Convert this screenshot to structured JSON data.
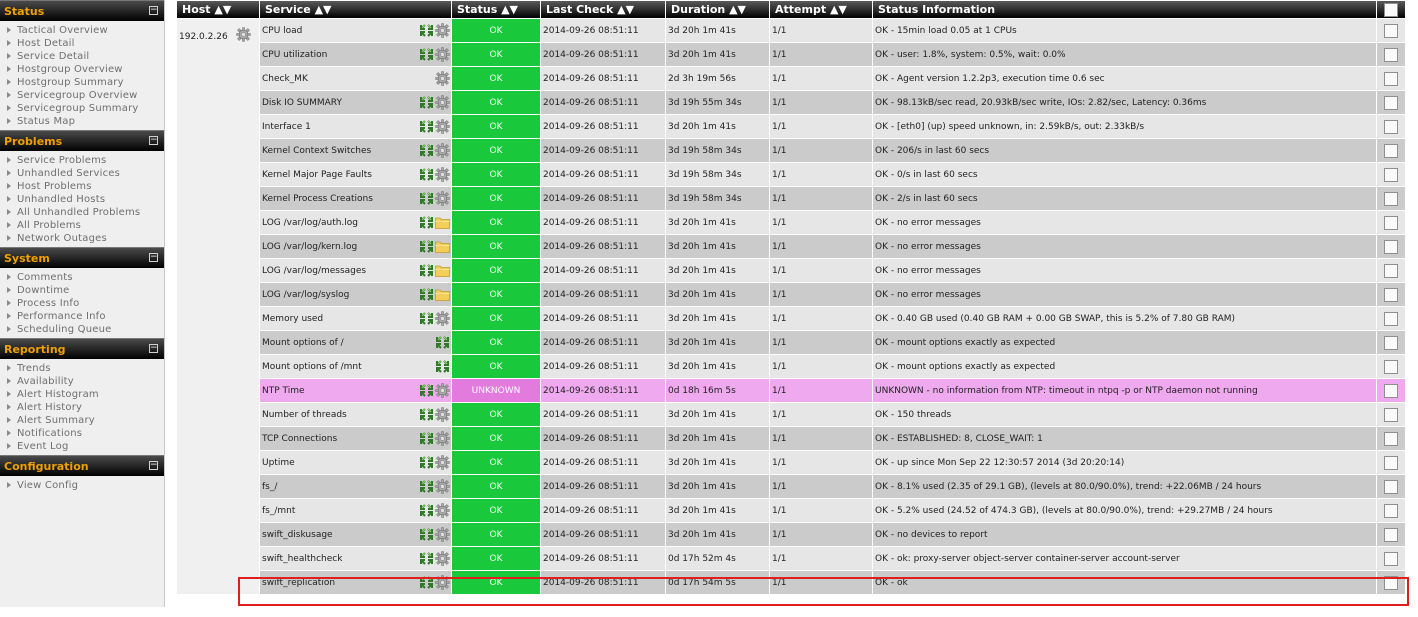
{
  "sidebar": {
    "sections": [
      {
        "title": "Status",
        "toggle": "⊟",
        "items": [
          "Tactical Overview",
          "Host Detail",
          "Service Detail",
          "Hostgroup Overview",
          "Hostgroup Summary",
          "Servicegroup Overview",
          "Servicegroup Summary",
          "Status Map"
        ]
      },
      {
        "title": "Problems",
        "toggle": "⊟",
        "items": [
          "Service Problems",
          "Unhandled Services",
          "Host Problems",
          "Unhandled Hosts",
          "All Unhandled Problems",
          "All Problems",
          "Network Outages"
        ]
      },
      {
        "title": "System",
        "toggle": "⊟",
        "items": [
          "Comments",
          "Downtime",
          "Process Info",
          "Performance Info",
          "Scheduling Queue"
        ]
      },
      {
        "title": "Reporting",
        "toggle": "⊟",
        "items": [
          "Trends",
          "Availability",
          "Alert Histogram",
          "Alert History",
          "Alert Summary",
          "Notifications",
          "Event Log"
        ]
      },
      {
        "title": "Configuration",
        "toggle": "⊟",
        "items": [
          "View Config"
        ]
      }
    ]
  },
  "table": {
    "columns": {
      "host": "Host",
      "service": "Service",
      "status": "Status",
      "last_check": "Last Check",
      "duration": "Duration",
      "attempt": "Attempt",
      "status_info": "Status Information"
    },
    "sort_glyph": "▲▼",
    "host": "192.0.2.26",
    "colors": {
      "ok": "#19c83b",
      "unknown": "#e37bde",
      "unknown_row": "#efa9ee",
      "highlight": "#e01e1e"
    },
    "rows": [
      {
        "service": "CPU load",
        "icons": [
          "graph-icon",
          "gear-icon"
        ],
        "status": "OK",
        "state": "ok",
        "last_check": "2014-09-26 08:51:11",
        "duration": "3d 20h 1m 41s",
        "attempt": "1/1",
        "info": "OK - 15min load 0.05 at 1 CPUs"
      },
      {
        "service": "CPU utilization",
        "icons": [
          "graph-icon",
          "gear-icon"
        ],
        "status": "OK",
        "state": "ok",
        "last_check": "2014-09-26 08:51:11",
        "duration": "3d 20h 1m 41s",
        "attempt": "1/1",
        "info": "OK - user: 1.8%, system: 0.5%, wait: 0.0%"
      },
      {
        "service": "Check_MK",
        "icons": [
          "gear-icon"
        ],
        "status": "OK",
        "state": "ok",
        "last_check": "2014-09-26 08:51:11",
        "duration": "2d 3h 19m 56s",
        "attempt": "1/1",
        "info": "OK - Agent version 1.2.2p3, execution time 0.6 sec"
      },
      {
        "service": "Disk IO SUMMARY",
        "icons": [
          "graph-icon",
          "gear-icon"
        ],
        "status": "OK",
        "state": "ok",
        "last_check": "2014-09-26 08:51:11",
        "duration": "3d 19h 55m 34s",
        "attempt": "1/1",
        "info": "OK - 98.13kB/sec read, 20.93kB/sec write, IOs: 2.82/sec, Latency: 0.36ms"
      },
      {
        "service": "Interface 1",
        "icons": [
          "graph-icon",
          "gear-icon"
        ],
        "status": "OK",
        "state": "ok",
        "last_check": "2014-09-26 08:51:11",
        "duration": "3d 20h 1m 41s",
        "attempt": "1/1",
        "info": "OK - [eth0] (up) speed unknown, in: 2.59kB/s, out: 2.33kB/s"
      },
      {
        "service": "Kernel Context Switches",
        "icons": [
          "graph-icon",
          "gear-icon"
        ],
        "status": "OK",
        "state": "ok",
        "last_check": "2014-09-26 08:51:11",
        "duration": "3d 19h 58m 34s",
        "attempt": "1/1",
        "info": "OK - 206/s in last 60 secs"
      },
      {
        "service": "Kernel Major Page Faults",
        "icons": [
          "graph-icon",
          "gear-icon"
        ],
        "status": "OK",
        "state": "ok",
        "last_check": "2014-09-26 08:51:11",
        "duration": "3d 19h 58m 34s",
        "attempt": "1/1",
        "info": "OK - 0/s in last 60 secs"
      },
      {
        "service": "Kernel Process Creations",
        "icons": [
          "graph-icon",
          "gear-icon"
        ],
        "status": "OK",
        "state": "ok",
        "last_check": "2014-09-26 08:51:11",
        "duration": "3d 19h 58m 34s",
        "attempt": "1/1",
        "info": "OK - 2/s in last 60 secs"
      },
      {
        "service": "LOG /var/log/auth.log",
        "icons": [
          "graph-icon",
          "folder-icon"
        ],
        "status": "OK",
        "state": "ok",
        "last_check": "2014-09-26 08:51:11",
        "duration": "3d 20h 1m 41s",
        "attempt": "1/1",
        "info": "OK - no error messages"
      },
      {
        "service": "LOG /var/log/kern.log",
        "icons": [
          "graph-icon",
          "folder-icon"
        ],
        "status": "OK",
        "state": "ok",
        "last_check": "2014-09-26 08:51:11",
        "duration": "3d 20h 1m 41s",
        "attempt": "1/1",
        "info": "OK - no error messages"
      },
      {
        "service": "LOG /var/log/messages",
        "icons": [
          "graph-icon",
          "folder-icon"
        ],
        "status": "OK",
        "state": "ok",
        "last_check": "2014-09-26 08:51:11",
        "duration": "3d 20h 1m 41s",
        "attempt": "1/1",
        "info": "OK - no error messages"
      },
      {
        "service": "LOG /var/log/syslog",
        "icons": [
          "graph-icon",
          "folder-icon"
        ],
        "status": "OK",
        "state": "ok",
        "last_check": "2014-09-26 08:51:11",
        "duration": "3d 20h 1m 41s",
        "attempt": "1/1",
        "info": "OK - no error messages"
      },
      {
        "service": "Memory used",
        "icons": [
          "graph-icon",
          "gear-icon"
        ],
        "status": "OK",
        "state": "ok",
        "last_check": "2014-09-26 08:51:11",
        "duration": "3d 20h 1m 41s",
        "attempt": "1/1",
        "info": "OK - 0.40 GB used (0.40 GB RAM + 0.00 GB SWAP, this is 5.2% of 7.80 GB RAM)"
      },
      {
        "service": "Mount options of /",
        "icons": [
          "graph-icon"
        ],
        "status": "OK",
        "state": "ok",
        "last_check": "2014-09-26 08:51:11",
        "duration": "3d 20h 1m 41s",
        "attempt": "1/1",
        "info": "OK - mount options exactly as expected"
      },
      {
        "service": "Mount options of /mnt",
        "icons": [
          "graph-icon"
        ],
        "status": "OK",
        "state": "ok",
        "last_check": "2014-09-26 08:51:11",
        "duration": "3d 20h 1m 41s",
        "attempt": "1/1",
        "info": "OK - mount options exactly as expected"
      },
      {
        "service": "NTP Time",
        "icons": [
          "graph-icon",
          "gear-icon"
        ],
        "status": "UNKNOWN",
        "state": "unknown",
        "last_check": "2014-09-26 08:51:11",
        "duration": "0d 18h 16m 5s",
        "attempt": "1/1",
        "info": "UNKNOWN - no information from NTP: timeout in ntpq -p or NTP daemon not running"
      },
      {
        "service": "Number of threads",
        "icons": [
          "graph-icon",
          "gear-icon"
        ],
        "status": "OK",
        "state": "ok",
        "last_check": "2014-09-26 08:51:11",
        "duration": "3d 20h 1m 41s",
        "attempt": "1/1",
        "info": "OK - 150 threads"
      },
      {
        "service": "TCP Connections",
        "icons": [
          "graph-icon",
          "gear-icon"
        ],
        "status": "OK",
        "state": "ok",
        "last_check": "2014-09-26 08:51:11",
        "duration": "3d 20h 1m 41s",
        "attempt": "1/1",
        "info": "OK - ESTABLISHED: 8, CLOSE_WAIT: 1"
      },
      {
        "service": "Uptime",
        "icons": [
          "graph-icon",
          "gear-icon"
        ],
        "status": "OK",
        "state": "ok",
        "last_check": "2014-09-26 08:51:11",
        "duration": "3d 20h 1m 41s",
        "attempt": "1/1",
        "info": "OK - up since Mon Sep 22 12:30:57 2014 (3d 20:20:14)"
      },
      {
        "service": "fs_/",
        "icons": [
          "graph-icon",
          "gear-icon"
        ],
        "status": "OK",
        "state": "ok",
        "last_check": "2014-09-26 08:51:11",
        "duration": "3d 20h 1m 41s",
        "attempt": "1/1",
        "info": "OK - 8.1% used (2.35 of 29.1 GB), (levels at 80.0/90.0%), trend: +22.06MB / 24 hours"
      },
      {
        "service": "fs_/mnt",
        "icons": [
          "graph-icon",
          "gear-icon"
        ],
        "status": "OK",
        "state": "ok",
        "last_check": "2014-09-26 08:51:11",
        "duration": "3d 20h 1m 41s",
        "attempt": "1/1",
        "info": "OK - 5.2% used (24.52 of 474.3 GB), (levels at 80.0/90.0%), trend: +29.27MB / 24 hours"
      },
      {
        "service": "swift_diskusage",
        "icons": [
          "graph-icon",
          "gear-icon"
        ],
        "status": "OK",
        "state": "ok",
        "last_check": "2014-09-26 08:51:11",
        "duration": "3d 20h 1m 41s",
        "attempt": "1/1",
        "info": "OK - no devices to report"
      },
      {
        "service": "swift_healthcheck",
        "icons": [
          "graph-icon",
          "gear-icon"
        ],
        "status": "OK",
        "state": "ok",
        "last_check": "2014-09-26 08:51:11",
        "duration": "0d 17h 52m 4s",
        "attempt": "1/1",
        "info": "OK - ok: proxy-server object-server container-server account-server"
      },
      {
        "service": "swift_replication",
        "icons": [
          "graph-icon",
          "gear-icon"
        ],
        "status": "OK",
        "state": "ok",
        "last_check": "2014-09-26 08:51:11",
        "duration": "0d 17h 54m 5s",
        "attempt": "1/1",
        "info": "OK - ok"
      }
    ]
  }
}
